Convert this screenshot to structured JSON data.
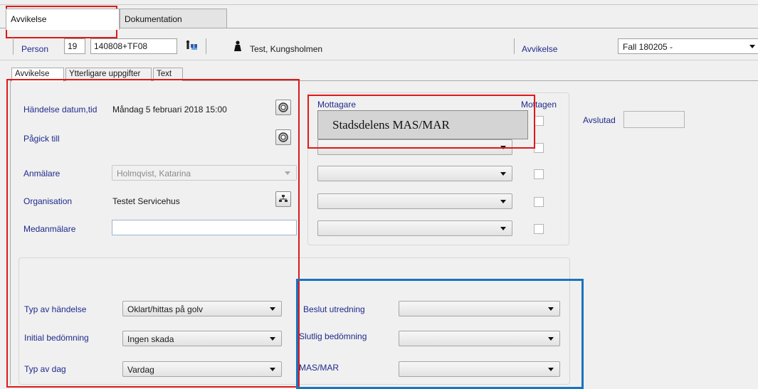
{
  "tabs": {
    "avvikelse": "Avvikelse",
    "dokumentation": "Dokumentation"
  },
  "person": {
    "label": "Person",
    "prefix": "19",
    "number": "140808+TF08",
    "name": "Test, Kungsholmen",
    "avvikelse_label": "Avvikelse",
    "avvikelse_value": "Fall 180205 -"
  },
  "subtabs": {
    "avvikelse": "Avvikelse",
    "ytterligare": "Ytterligare uppgifter",
    "text": "Text"
  },
  "form": {
    "handelse_label": "Händelse datum,tid",
    "handelse_value": "Måndag 5 februari 2018 15:00",
    "pagick_label": "Pågick till",
    "anmalare_label": "Anmälare",
    "anmalare_value": "Holmqvist, Katarina",
    "organisation_label": "Organisation",
    "organisation_value": "Testet Servicehus",
    "medanmalare_label": "Medanmälare",
    "medanmalare_value": ""
  },
  "mottagare": {
    "header": "Mottagare",
    "mottagen_header": "Mottagen",
    "popup_text": "Stadsdelens MAS/MAR",
    "avslutad_label": "Avslutad"
  },
  "lower": {
    "typ_handelse_label": "Typ av händelse",
    "typ_handelse_value": "Oklart/hittas på golv",
    "initial_label": "Initial bedömning",
    "initial_value": "Ingen skada",
    "typ_dag_label": "Typ av dag",
    "typ_dag_value": "Vardag",
    "beslut_label": "Beslut utredning",
    "slutlig_label": "Slutlig bedömning",
    "masmar_label": "MAS/MAR"
  }
}
